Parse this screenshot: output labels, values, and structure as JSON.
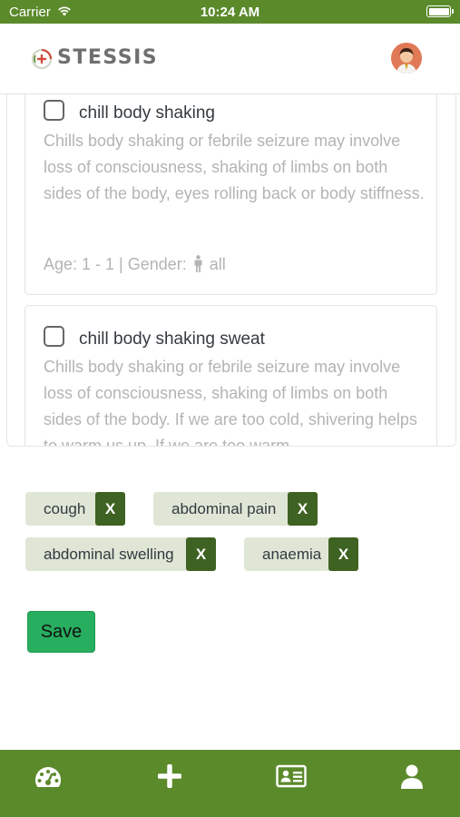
{
  "status_bar": {
    "carrier": "Carrier",
    "time": "10:24 AM",
    "icons": [
      "wifi-icon",
      "battery-icon"
    ]
  },
  "header": {
    "app_name": "STESSIS",
    "logo_icon": "stessis-logo-icon",
    "avatar_icon": "user-avatar"
  },
  "symptoms": [
    {
      "title": "chill body shaking",
      "description": "Chills body shaking or febrile seizure may involve loss of consciousness, shaking of limbs on both sides of the body, eyes rolling back or body stiffness.",
      "meta_prefix": "Age: 1 - 1 | Gender:",
      "gender": "all",
      "checked": false
    },
    {
      "title": "chill body shaking sweat",
      "description": "Chills body shaking or febrile seizure may involve loss of consciousness, shaking of limbs on both sides of the body. If we are too cold, shivering helps to warm us up. If we are too warm,",
      "checked": false
    }
  ],
  "selected_tags": [
    {
      "label": "cough",
      "remove_label": "X"
    },
    {
      "label": "abdominal pain",
      "remove_label": "X"
    },
    {
      "label": "abdominal swelling",
      "remove_label": "X"
    },
    {
      "label": "anaemia",
      "remove_label": "X"
    }
  ],
  "actions": {
    "save_label": "Save"
  },
  "tab_bar": {
    "items": [
      {
        "icon": "dashboard-icon"
      },
      {
        "icon": "plus-icon"
      },
      {
        "icon": "id-card-icon"
      },
      {
        "icon": "user-icon"
      }
    ]
  },
  "colors": {
    "brand_green": "#5b8a2b",
    "tag_background": "#dfe6d6",
    "tag_remove": "#3e6221",
    "save_button": "#27ae5f",
    "muted_text": "#b4b4b4"
  }
}
